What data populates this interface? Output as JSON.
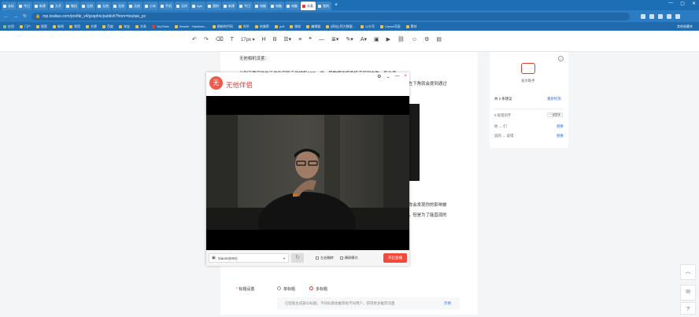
{
  "browser": {
    "tabs": [
      {
        "label": "去标"
      },
      {
        "label": "今日"
      },
      {
        "label": "新建"
      },
      {
        "label": "大开"
      },
      {
        "label": "微信"
      },
      {
        "label": "无他"
      },
      {
        "label": "无他"
      },
      {
        "label": "无他"
      },
      {
        "label": "无他"
      },
      {
        "label": "小米"
      },
      {
        "label": "手机"
      },
      {
        "label": "无时"
      },
      {
        "label": "Apk"
      },
      {
        "label": "我的"
      },
      {
        "label": "新建"
      },
      {
        "label": "今日"
      },
      {
        "label": "电脑"
      },
      {
        "label": "电脑"
      },
      {
        "label": "电脑"
      },
      {
        "label": "头条"
      },
      {
        "label": "我的"
      }
    ],
    "new_tab": "+",
    "url": "mp.toutiao.com/profile_v4/graphic/publish?from=toutiao_pc",
    "bookmarks": [
      {
        "label": "应用",
        "icon": "apps-icon"
      },
      {
        "label": "门户",
        "icon": "folder-icon"
      },
      {
        "label": "搜索",
        "icon": "folder-icon"
      },
      {
        "label": "新闻",
        "icon": "folder-icon"
      },
      {
        "label": "常用",
        "icon": "folder-icon"
      },
      {
        "label": "方便",
        "icon": "folder-icon"
      },
      {
        "label": "百度",
        "icon": "folder-icon"
      },
      {
        "label": "淘宝",
        "icon": "folder-icon"
      },
      {
        "label": "头条",
        "icon": "folder-icon"
      },
      {
        "label": "YouTube",
        "icon": "youtube-icon"
      },
      {
        "label": "Search · Hackinto...",
        "icon": "folder-icon"
      },
      {
        "label": "刷新的代码",
        "icon": "folder-icon"
      },
      {
        "label": "知乎",
        "icon": "folder-icon"
      },
      {
        "label": "给美帮",
        "icon": "folder-icon"
      },
      {
        "label": "pc6",
        "icon": "folder-icon"
      },
      {
        "label": "微软",
        "icon": "folder-icon"
      },
      {
        "label": "编辑器",
        "icon": "folder-icon"
      },
      {
        "label": "[网站] 阿大数据...",
        "icon": "folder-icon"
      },
      {
        "label": "公众号",
        "icon": "folder-icon"
      },
      {
        "label": "Canva可画",
        "icon": "folder-icon"
      },
      {
        "label": "素材",
        "icon": "folder-icon"
      }
    ],
    "bookmarks_right": "其他收藏夹"
  },
  "toolbar": {
    "font_size": "17px",
    "bold": "B"
  },
  "article": {
    "heading": "无他相机设置：",
    "line1": "分别下载安装的无他伴侣和无他相机APP，并一般数据线将手机连接到电脑，每个手",
    "line2_tail": "左下角就会提到通过",
    "line3_tail": "你会发现你的影响被",
    "line4_tail": "，但是为了能直现的"
  },
  "camera_window": {
    "logo": "无",
    "title": "无他伴侣",
    "device": "Xiaomi(MIX)",
    "mirror_label": "左右翻转",
    "landscape_label": "横屏模式",
    "start_label": "开启直播",
    "close_icon": "×"
  },
  "sidebar": {
    "top_label": "发文助手",
    "suggestions": "共 2 条建议",
    "recheck": "重新检测",
    "typo_title": "2 处错别字",
    "ignore_all": "一键替换",
    "typo1": "他 → 们",
    "typo1_action": "替换",
    "typo2": "说的 → 说得",
    "typo2_action": "替换"
  },
  "form": {
    "label": "标题设置",
    "required": "*",
    "option1": "单标题",
    "option2": "多标题",
    "hint": "已智能生成部分标题，不同标题会推荐给不同用户，获得更多推荐流量",
    "hint_link": "示例"
  }
}
